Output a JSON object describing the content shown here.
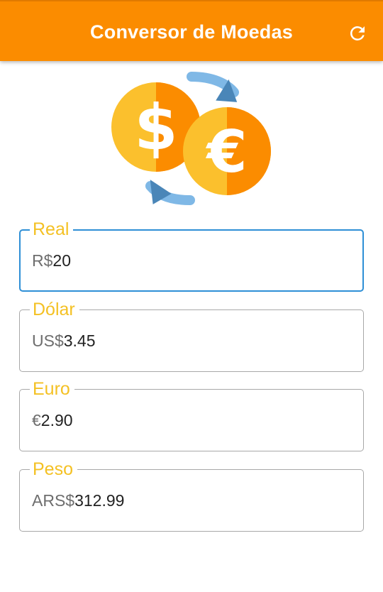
{
  "app": {
    "title": "Conversor de Moedas",
    "refresh_icon": "refresh-icon",
    "accent_color": "#fb8c00",
    "label_color": "#f4c124",
    "focus_color": "#2e8fd6"
  },
  "logo": {
    "icon": "currency-exchange-icon",
    "symbols": [
      "$",
      "€"
    ]
  },
  "fields": [
    {
      "label": "Real",
      "prefix": "R$",
      "value": "20",
      "focused": true
    },
    {
      "label": "Dólar",
      "prefix": "US$",
      "value": "3.45",
      "focused": false
    },
    {
      "label": "Euro",
      "prefix": "€",
      "value": "2.90",
      "focused": false
    },
    {
      "label": "Peso",
      "prefix": "ARS$",
      "value": "312.99",
      "focused": false
    }
  ]
}
